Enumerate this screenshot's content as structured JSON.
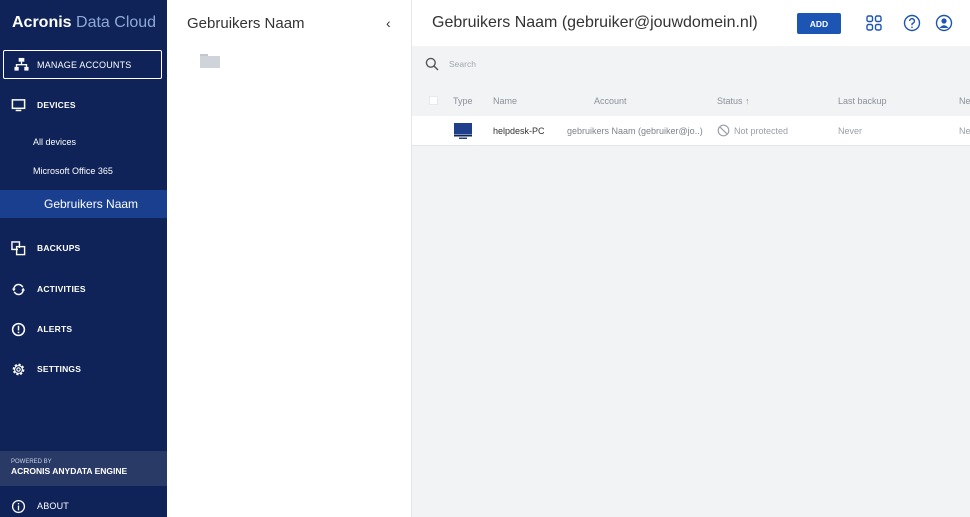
{
  "sidebar": {
    "brand_bold": "Acronis",
    "brand_light": " Data Cloud",
    "manage_accounts": "MANAGE ACCOUNTS",
    "devices": "DEVICES",
    "sub_items": [
      "All devices",
      "Microsoft Office 365",
      "Gebruikers Naam"
    ],
    "backups": "BACKUPS",
    "activities": "ACTIVITIES",
    "alerts": "ALERTS",
    "settings": "SETTINGS",
    "powered_by": "POWERED BY",
    "engine": "ACRONIS ANYDATA ENGINE",
    "about": "ABOUT"
  },
  "middle": {
    "title": "Gebruikers Naam",
    "collapse_glyph": "‹"
  },
  "main": {
    "title": "Gebruikers Naam (gebruiker@jouwdomein.nl)",
    "add_label": "ADD",
    "search_placeholder": "Search",
    "columns": {
      "type": "Type",
      "name": "Name",
      "account": "Account",
      "status": "Status ↑",
      "last_backup": "Last backup",
      "next": "Ne"
    },
    "rows": [
      {
        "name": "helpdesk-PC",
        "account": "gebruikers Naam (gebruiker@jo..)",
        "status": "Not protected",
        "last_backup": "Never",
        "next": "Ne"
      }
    ]
  },
  "colors": {
    "sidebar_bg": "#0f2359",
    "active_bg": "#1a3f8f",
    "accent": "#1d55b5",
    "main_bg": "#f2f3f5"
  }
}
